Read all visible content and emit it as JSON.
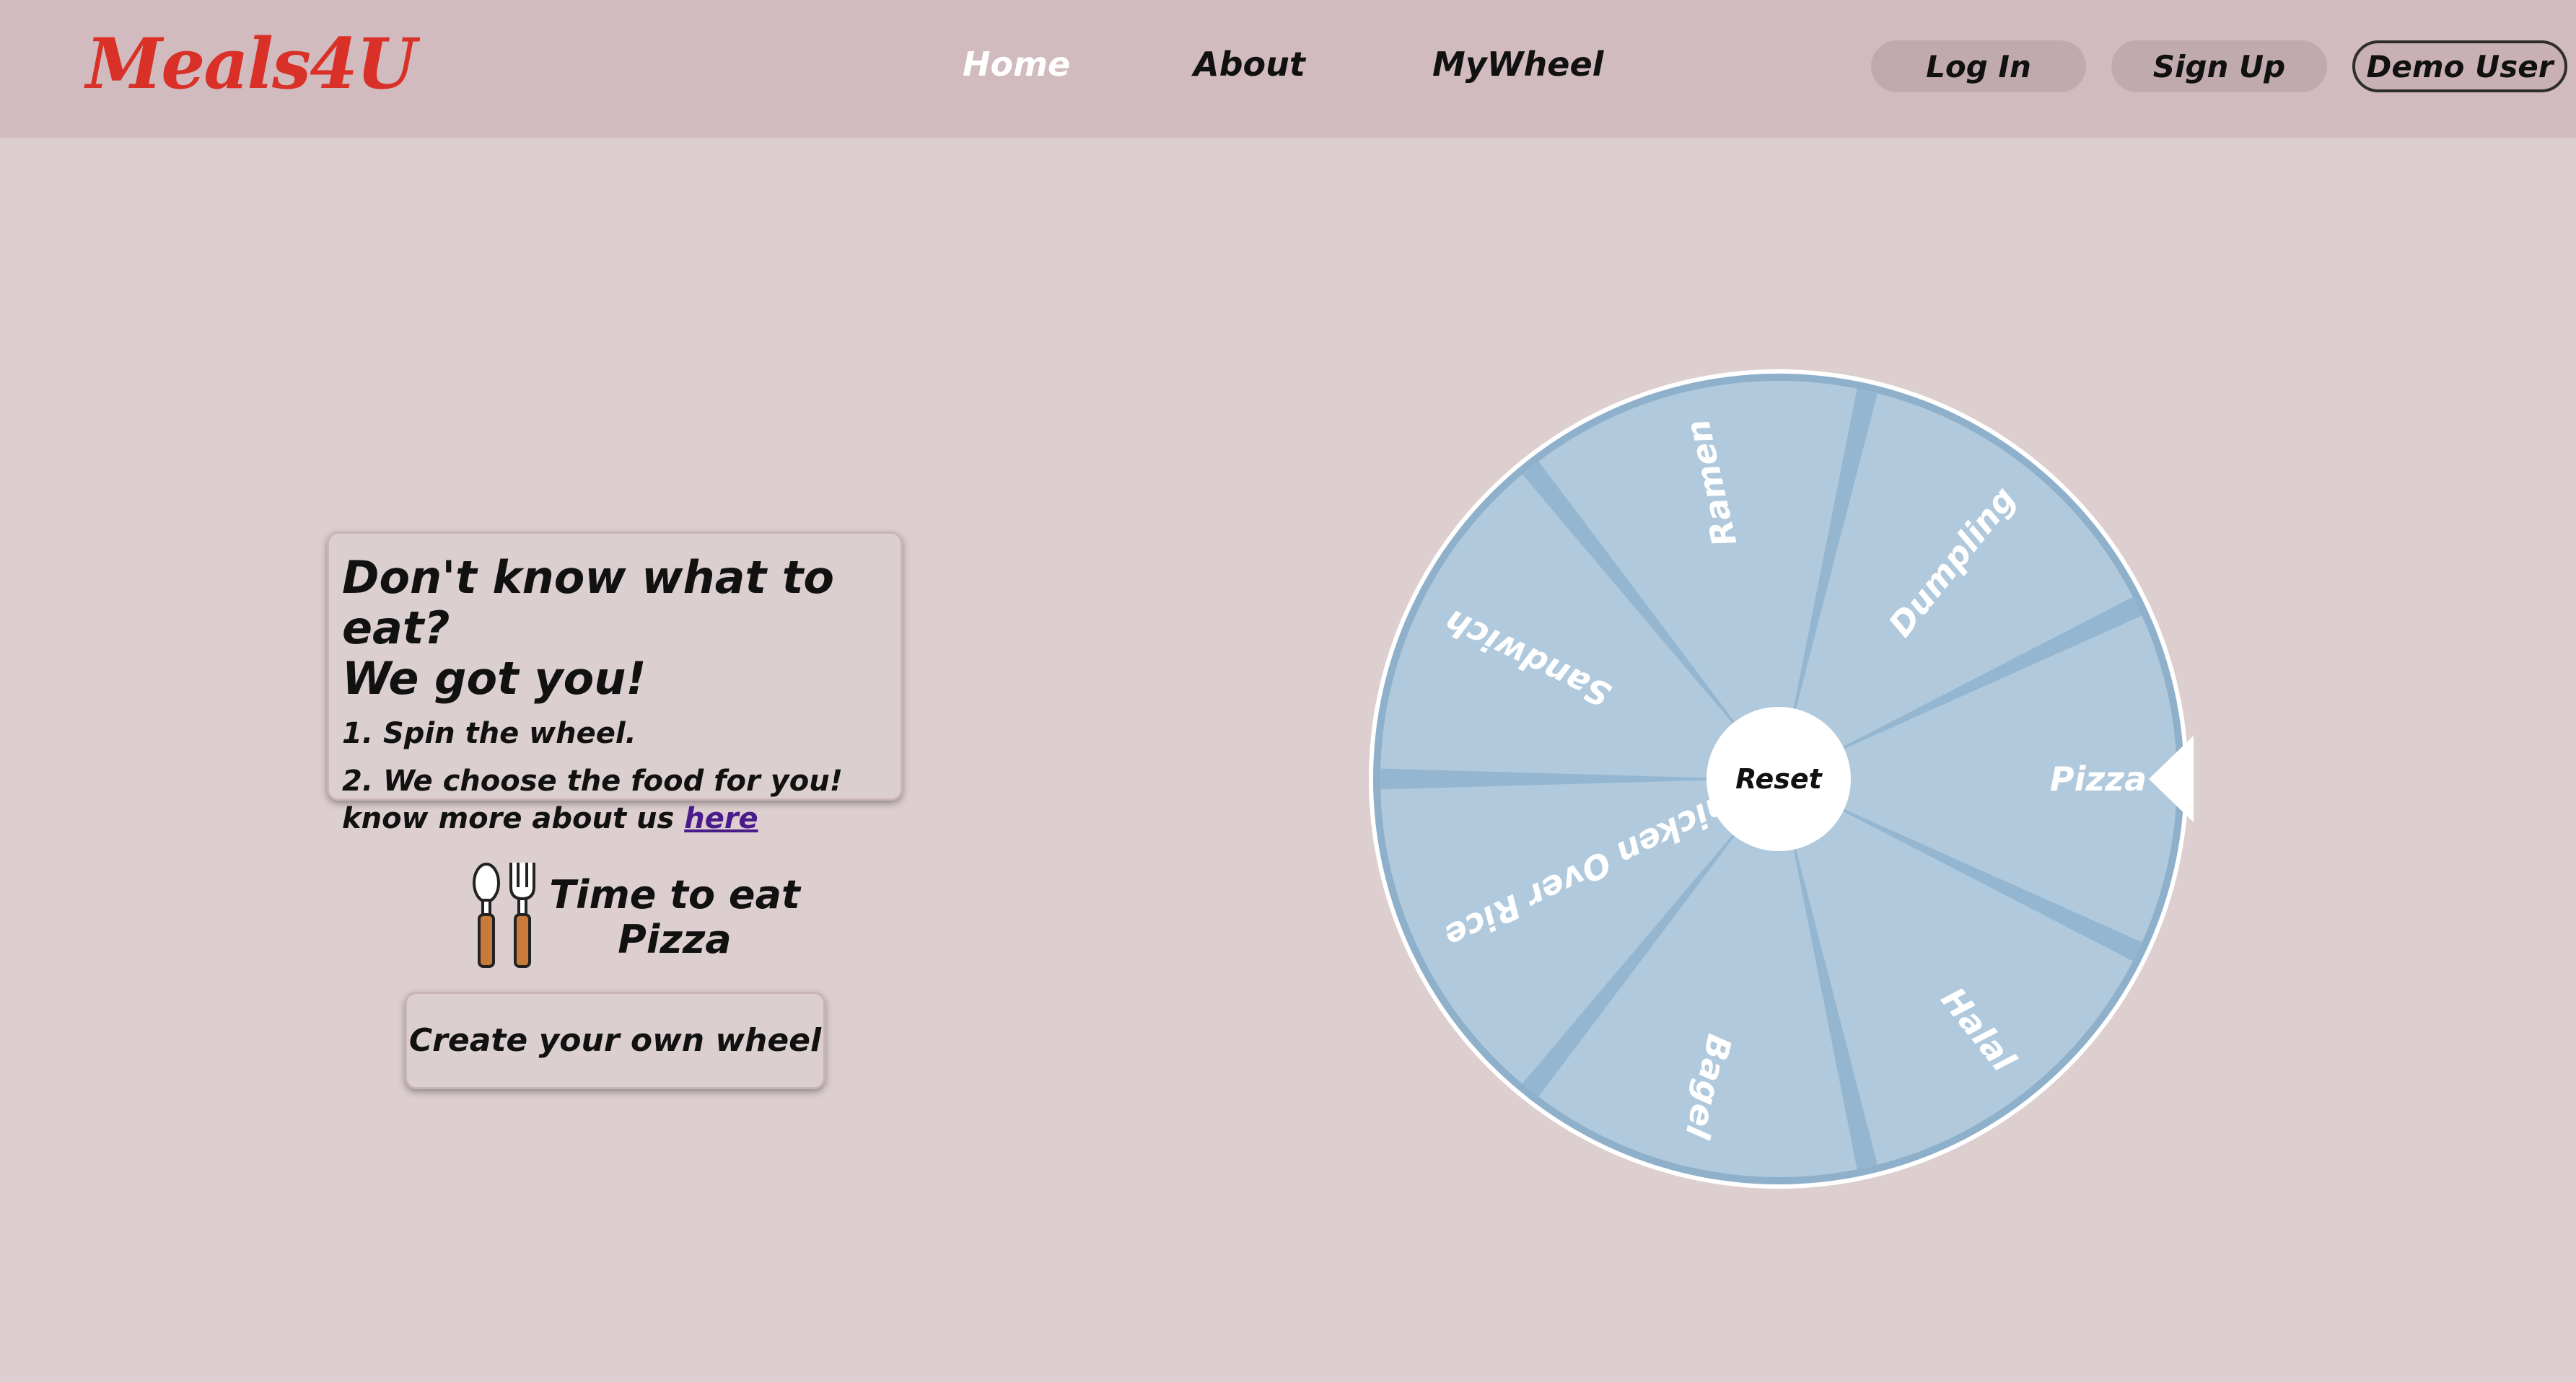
{
  "brand": {
    "logo_text": "Meals4U",
    "logo_color": "#d93128"
  },
  "nav": {
    "links": [
      {
        "label": "Home",
        "active": true
      },
      {
        "label": "About",
        "active": false
      },
      {
        "label": "MyWheel",
        "active": false
      }
    ],
    "login_label": "Log In",
    "signup_label": "Sign Up",
    "user_label": "Demo User"
  },
  "info_card": {
    "heading_line1": "Don't know what to eat?",
    "heading_line2": "We got you!",
    "step1": "1. Spin the wheel.",
    "step2": "2. We choose the food for you!",
    "more_prefix": "know more about us ",
    "more_link": "here"
  },
  "result": {
    "icon": "spoon-fork-icon",
    "line1": "Time to eat",
    "line2": "Pizza"
  },
  "create_button_label": "Create your own wheel",
  "wheel": {
    "segments": [
      "Pizza",
      "Halal",
      "Bagel",
      "Chicken Over Rice",
      "Sandwich",
      "Ramen",
      "Dumpling"
    ],
    "center_label": "Reset",
    "selected": "Pizza",
    "colors": {
      "segment": "#b0c9dc",
      "divider": "#95b6d0",
      "rim": "#8fb0ca",
      "hub": "#ffffff",
      "pointer": "#ffffff"
    }
  },
  "colors": {
    "page_bg": "#ddcfd0",
    "nav_bg": "#d1bbbf",
    "pill_bg": "#c0aaae"
  }
}
